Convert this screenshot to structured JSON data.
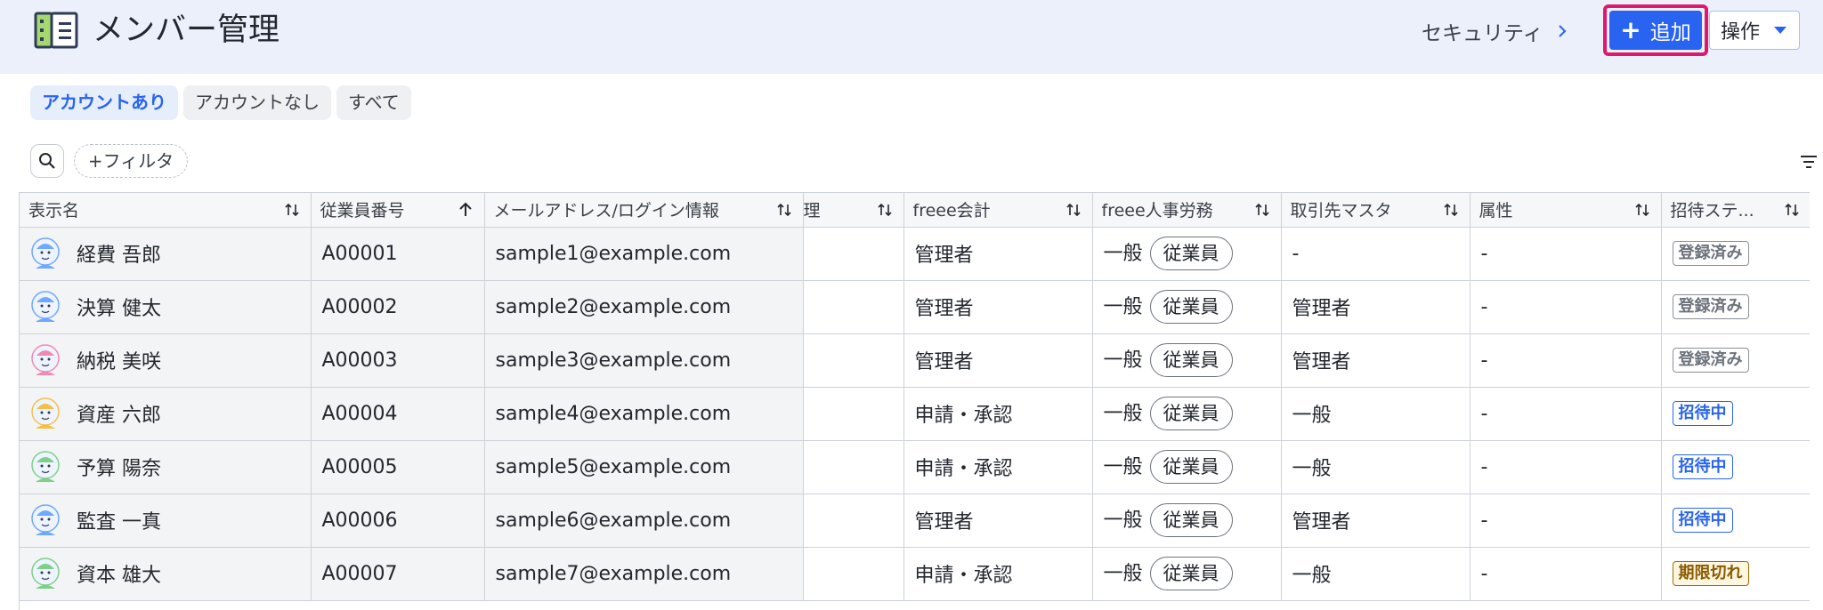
{
  "header": {
    "title": "メンバー管理",
    "security_link": "セキュリティ",
    "add_button": "追加",
    "ops_button": "操作"
  },
  "tabs": [
    {
      "label": "アカウントあり",
      "active": true
    },
    {
      "label": "アカウントなし",
      "active": false
    },
    {
      "label": "すべて",
      "active": false
    }
  ],
  "toolbar": {
    "filter_label": "+フィルタ"
  },
  "table": {
    "columns": [
      "表示名",
      "従業員番号",
      "メールアドレス/ログイン情報",
      "理",
      "freee会計",
      "freee人事労務",
      "取引先マスタ",
      "属性",
      "招待ステ..."
    ],
    "employee_pill": "従業員",
    "rows": [
      {
        "name": "経費 吾郎",
        "emp_no": "A00001",
        "email": "sample1@example.com",
        "accounting": "管理者",
        "hr": "一般",
        "partner": "-",
        "attr": "-",
        "status": "登録済み",
        "status_type": "registered"
      },
      {
        "name": "決算 健太",
        "emp_no": "A00002",
        "email": "sample2@example.com",
        "accounting": "管理者",
        "hr": "一般",
        "partner": "管理者",
        "attr": "-",
        "status": "登録済み",
        "status_type": "registered"
      },
      {
        "name": "納税 美咲",
        "emp_no": "A00003",
        "email": "sample3@example.com",
        "accounting": "管理者",
        "hr": "一般",
        "partner": "管理者",
        "attr": "-",
        "status": "登録済み",
        "status_type": "registered"
      },
      {
        "name": "資産 六郎",
        "emp_no": "A00004",
        "email": "sample4@example.com",
        "accounting": "申請・承認",
        "hr": "一般",
        "partner": "一般",
        "attr": "-",
        "status": "招待中",
        "status_type": "inviting"
      },
      {
        "name": "予算 陽奈",
        "emp_no": "A00005",
        "email": "sample5@example.com",
        "accounting": "申請・承認",
        "hr": "一般",
        "partner": "一般",
        "attr": "-",
        "status": "招待中",
        "status_type": "inviting"
      },
      {
        "name": "監査 一真",
        "emp_no": "A00006",
        "email": "sample6@example.com",
        "accounting": "管理者",
        "hr": "一般",
        "partner": "管理者",
        "attr": "-",
        "status": "招待中",
        "status_type": "inviting"
      },
      {
        "name": "資本 雄大",
        "emp_no": "A00007",
        "email": "sample7@example.com",
        "accounting": "申請・承認",
        "hr": "一般",
        "partner": "一般",
        "attr": "-",
        "status": "期限切れ",
        "status_type": "expired"
      }
    ]
  },
  "colors": {
    "accent": "#2864f0",
    "highlight_border": "#e0186c",
    "header_bg": "#ebf0fb"
  }
}
